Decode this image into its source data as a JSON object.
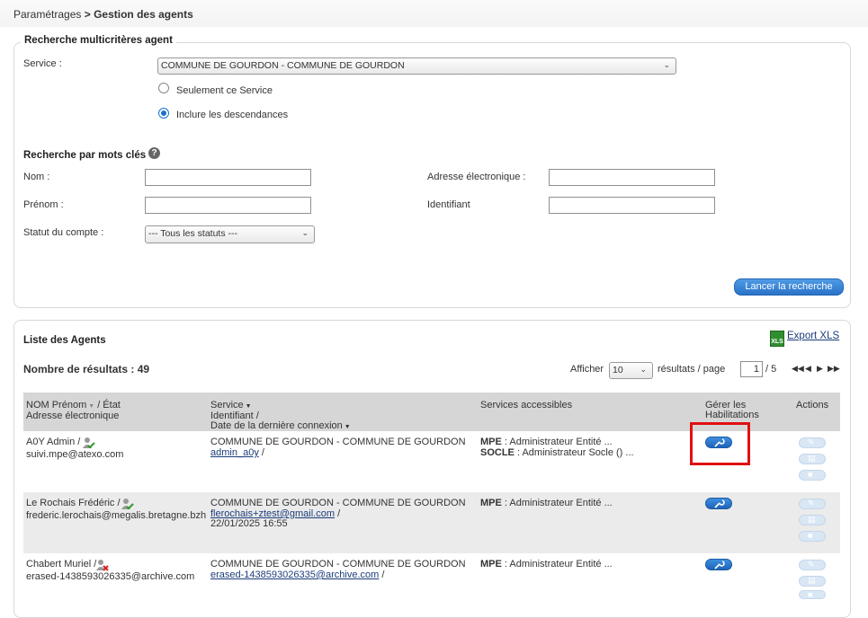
{
  "breadcrumb": {
    "parent": "Paramétrages",
    "separator": ">",
    "current": "Gestion des agents"
  },
  "search_panel": {
    "title": "Recherche multicritères agent",
    "service_label": "Service :",
    "service_value": "COMMUNE DE GOURDON - COMMUNE DE GOURDON",
    "radio_only": "Seulement ce Service",
    "radio_include": "Inclure les descendances",
    "radio_selected": "include",
    "keywords_title": "Recherche par mots clés",
    "nom_label": "Nom :",
    "prenom_label": "Prénom :",
    "statut_label": "Statut du compte :",
    "statut_value": "--- Tous les statuts ---",
    "email_label": "Adresse électronique :",
    "identifiant_label": "Identifiant",
    "submit_label": "Lancer la recherche"
  },
  "list_panel": {
    "title": "Liste des Agents",
    "export_label": "Export XLS",
    "results_label": "Nombre de résultats : 49",
    "afficher_label": "Afficher",
    "per_page_value": "10",
    "per_page_suffix": "résultats / page",
    "page_current": "1",
    "page_total": "/ 5",
    "headers": {
      "col1_line1": "NOM Prénom",
      "col1_etat": "/ État",
      "col1_line2": "Adresse électronique",
      "col2_line1": "Service",
      "col2_line2": "Identifiant /",
      "col2_line3": "Date de la dernière connexion",
      "col3": "Services accessibles",
      "col4_line1": "Gérer les",
      "col4_line2": "Habilitations",
      "col5": "Actions"
    },
    "rows": [
      {
        "name": "A0Y Admin /",
        "email": "suivi.mpe@atexo.com",
        "status": "active",
        "service": "COMMUNE DE GOURDON - COMMUNE DE GOURDON",
        "identifiant": "admin_a0y",
        "id_suffix": "/",
        "last_login": "",
        "access1_key": "MPE",
        "access1_val": ": Administrateur Entité  ...",
        "access2_key": "SOCLE",
        "access2_val": ": Administrateur Socle ()  ..."
      },
      {
        "name": "Le Rochais Frédéric /",
        "email": "frederic.lerochais@megalis.bretagne.bzh",
        "status": "active",
        "service": "COMMUNE DE GOURDON - COMMUNE DE GOURDON",
        "identifiant": "flerochais+ztest@gmail.com",
        "id_suffix": "/",
        "last_login": "22/01/2025 16:55",
        "access1_key": "MPE",
        "access1_val": ": Administrateur Entité  ...",
        "access2_key": "",
        "access2_val": ""
      },
      {
        "name": "Chabert Muriel /",
        "email": "erased-1438593026335@archive.com",
        "status": "deleted",
        "service": "COMMUNE DE GOURDON - COMMUNE DE GOURDON",
        "identifiant": "erased-1438593026335@archive.com",
        "id_suffix": "/",
        "last_login": "",
        "access1_key": "MPE",
        "access1_val": ": Administrateur Entité  ...",
        "access2_key": "",
        "access2_val": ""
      }
    ]
  },
  "colors": {
    "accent": "#2a72c7",
    "highlight": "#e01010",
    "table_header": "#d6d6d6",
    "row_alt": "#ebebeb"
  }
}
